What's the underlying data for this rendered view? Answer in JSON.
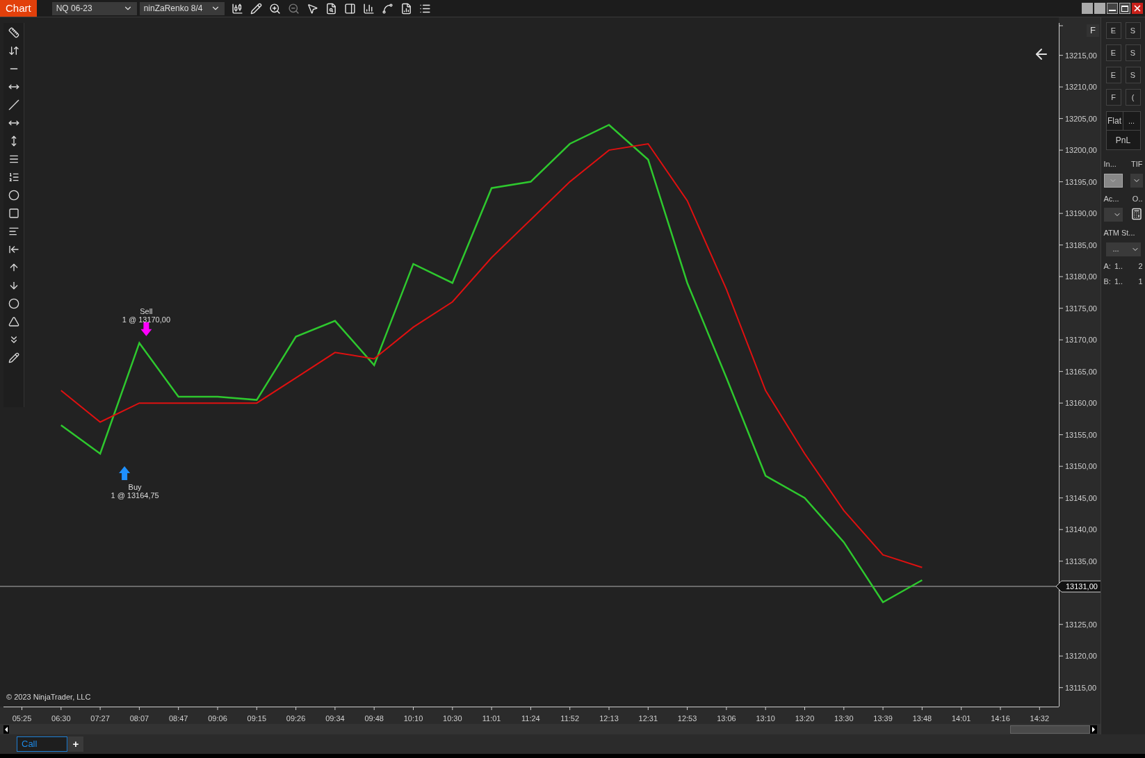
{
  "app_tab": "Chart",
  "instrument": {
    "value": "NQ 06-23"
  },
  "bar_type": {
    "value": "ninZaRenko 8/4"
  },
  "chart": {
    "corner_button": "F",
    "copyright": "© 2023 NinjaTrader, LLC",
    "trades": [
      {
        "kind": "sell"
      },
      {
        "kind": "buy"
      }
    ],
    "chart_data": {
      "type": "line",
      "categories": [
        "05:25",
        "06:30",
        "07:27",
        "08:07",
        "08:47",
        "09:06",
        "09:15",
        "09:26",
        "09:34",
        "09:48",
        "10:10",
        "10:30",
        "11:01",
        "11:24",
        "11:52",
        "12:13",
        "12:31",
        "12:53",
        "13:06",
        "13:10",
        "13:20",
        "13:30",
        "13:39",
        "13:48",
        "14:01",
        "14:16",
        "14:32"
      ],
      "series": [
        {
          "color": "#2ec82e",
          "values": [
            null,
            13156.5,
            13152,
            13169.5,
            13161,
            13161,
            13160.5,
            13170.5,
            13173,
            13166,
            13182,
            13179,
            13194,
            13195,
            13201,
            13204,
            13198.5,
            13179,
            13164,
            13148.5,
            13145,
            13138,
            13128.5,
            13132,
            null,
            null,
            null
          ]
        },
        {
          "color": "#e01010",
          "values": [
            null,
            13162,
            13157,
            13160,
            13160,
            13160,
            13160,
            13164,
            13168,
            13167,
            13172,
            13176,
            13183,
            13189,
            13195,
            13200,
            13201,
            13192,
            13178,
            13162,
            13152,
            13143,
            13136,
            13134,
            null,
            null,
            null
          ]
        }
      ],
      "ylim": [
        13112,
        13221
      ],
      "yticks": [
        {
          "value": 13115,
          "label": "13115,00"
        },
        {
          "value": 13120,
          "label": "13120,00"
        },
        {
          "value": 13125,
          "label": "13125,00"
        },
        {
          "value": 13135,
          "label": "13135,00"
        },
        {
          "value": 13140,
          "label": "13140,00"
        },
        {
          "value": 13145,
          "label": "13145,00"
        },
        {
          "value": 13150,
          "label": "13150,00"
        },
        {
          "value": 13155,
          "label": "13155,00"
        },
        {
          "value": 13160,
          "label": "13160,00"
        },
        {
          "value": 13165,
          "label": "13165,00"
        },
        {
          "value": 13170,
          "label": "13170,00"
        },
        {
          "value": 13175,
          "label": "13175,00"
        },
        {
          "value": 13180,
          "label": "13180,00"
        },
        {
          "value": 13185,
          "label": "13185,00"
        },
        {
          "value": 13190,
          "label": "13190,00"
        },
        {
          "value": 13195,
          "label": "13195,00"
        },
        {
          "value": 13200,
          "label": "13200,00"
        },
        {
          "value": 13205,
          "label": "13205,00"
        },
        {
          "value": 13210,
          "label": "13210,00"
        },
        {
          "value": 13215,
          "label": "13215,00"
        }
      ],
      "ref_lines": [
        {
          "axis": "y",
          "value": 13131,
          "label": "13131,00"
        }
      ],
      "annotations": [
        "Sell",
        "1 @ 13170,00",
        "Buy",
        "1 @ 13164,75"
      ]
    }
  },
  "order_panel": {
    "quick_buttons": [
      {
        "label": "E"
      },
      {
        "label": "S"
      },
      {
        "label": "E"
      },
      {
        "label": "S"
      },
      {
        "label": "E"
      },
      {
        "label": "S"
      },
      {
        "label": "F"
      },
      {
        "label": "("
      }
    ],
    "position": "Flat",
    "position_more": "...",
    "pnl": "PnL",
    "instrument_label": "In...",
    "tif_label": "TIF",
    "account_label": "Ac...",
    "quantity_label": "O..",
    "atm_label": "ATM St...",
    "atm_value": "...",
    "ask": {
      "label": "A:",
      "price": "1..",
      "size": "2"
    },
    "bid": {
      "label": "B:",
      "price": "1..",
      "size": "1"
    }
  },
  "tabs": [
    {
      "label": "Call",
      "selected": true
    }
  ],
  "add_tab": "+"
}
